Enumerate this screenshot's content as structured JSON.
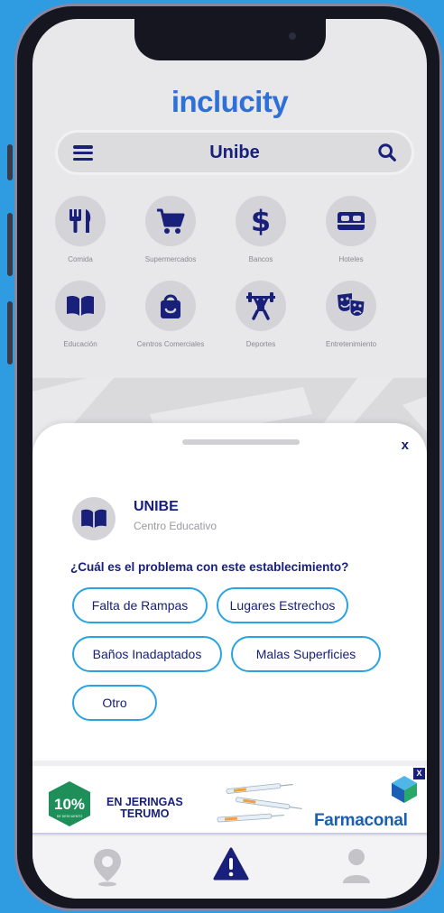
{
  "app": {
    "name": "inclucity"
  },
  "search": {
    "title": "Unibe"
  },
  "categories": [
    {
      "label": "Comida",
      "icon": "utensils-icon"
    },
    {
      "label": "Supermercados",
      "icon": "shopping-cart-icon"
    },
    {
      "label": "Bancos",
      "icon": "dollar-icon"
    },
    {
      "label": "Hoteles",
      "icon": "bed-icon"
    },
    {
      "label": "Educación",
      "icon": "book-icon"
    },
    {
      "label": "Centros Comerciales",
      "icon": "shopping-bag-icon"
    },
    {
      "label": "Deportes",
      "icon": "weightlifter-icon"
    },
    {
      "label": "Entretenimiento",
      "icon": "theater-masks-icon"
    }
  ],
  "sheet": {
    "close_label": "x",
    "establishment": {
      "name": "UNIBE",
      "type": "Centro Educativo",
      "icon": "book-icon"
    },
    "question": "¿Cuál es el problema con este establecimiento?",
    "options": [
      "Falta de Rampas",
      "Lugares Estrechos",
      "Baños Inadaptados",
      "Malas Superficies",
      "Otro"
    ]
  },
  "ad": {
    "close_label": "X",
    "discount": "10%",
    "discount_sub": "DE DESCUENTO",
    "line1": "EN JERINGAS",
    "line2": "TERUMO",
    "brand": "Farmaconal"
  },
  "tabs": [
    {
      "icon": "map-pin-icon",
      "active": false
    },
    {
      "icon": "warning-icon",
      "active": true
    },
    {
      "icon": "user-icon",
      "active": false
    }
  ],
  "colors": {
    "primary": "#18207a",
    "accent": "#2aa3e3",
    "logo": "#2e6fd8",
    "background": "#2f9be0",
    "discount_green": "#1f8f5a"
  }
}
